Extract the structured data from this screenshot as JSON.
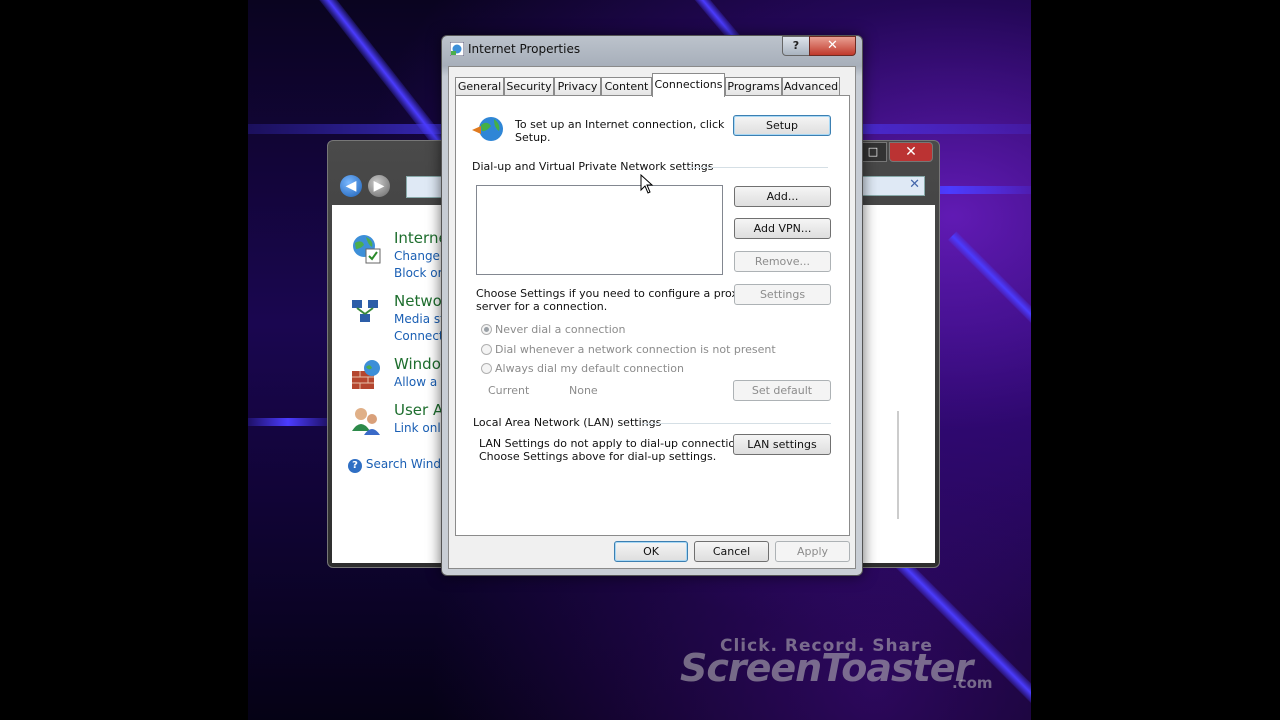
{
  "dialog": {
    "title": "Internet Properties",
    "help_button": "?",
    "close_button": "✕",
    "tabs": [
      {
        "label": "General"
      },
      {
        "label": "Security"
      },
      {
        "label": "Privacy"
      },
      {
        "label": "Content"
      },
      {
        "label": "Connections",
        "active": true
      },
      {
        "label": "Programs"
      },
      {
        "label": "Advanced"
      }
    ],
    "setup": {
      "text_line1": "To set up an Internet connection, click",
      "text_line2": "Setup.",
      "button": "Setup"
    },
    "dialup": {
      "heading": "Dial-up and Virtual Private Network settings",
      "add_button": "Add...",
      "add_vpn_button": "Add VPN...",
      "remove_button": "Remove...",
      "settings_button": "Settings",
      "proxy_text_line1": "Choose Settings if you need to configure a proxy",
      "proxy_text_line2": "server for a connection.",
      "radios": [
        {
          "label": "Never dial a connection",
          "checked": true
        },
        {
          "label": "Dial whenever a network connection is not present",
          "checked": false
        },
        {
          "label": "Always dial my default connection",
          "checked": false
        }
      ],
      "current_label": "Current",
      "current_value": "None",
      "set_default_button": "Set default"
    },
    "lan": {
      "heading": "Local Area Network (LAN) settings",
      "text_line1": "LAN Settings do not apply to dial-up connections.",
      "text_line2": "Choose Settings above for dial-up settings.",
      "button": "LAN settings"
    },
    "footer": {
      "ok": "OK",
      "cancel": "Cancel",
      "apply": "Apply"
    }
  },
  "control_panel": {
    "close_button": "✕",
    "max_button": "□",
    "search_clear": "✕",
    "items": [
      {
        "title": "Interne",
        "links": [
          "Change",
          "Block or"
        ],
        "icon": "internet-options-icon"
      },
      {
        "title": "Netwo",
        "links": [
          "Media st",
          "Connect"
        ],
        "icon": "network-icon"
      },
      {
        "title": "Windo",
        "links": [
          "Allow a p"
        ],
        "icon": "firewall-icon"
      },
      {
        "title": "User A",
        "links": [
          "Link onl"
        ],
        "icon": "user-accounts-icon"
      }
    ],
    "help_link": "Search Windo"
  },
  "watermark": {
    "tagline": "Click. Record. Share",
    "brand": "ScreenToaster",
    "suffix": ".com"
  },
  "colors": {
    "dialog_frame": "#a7afba",
    "link": "#1a5fb4",
    "cp_title": "#1e6e2e",
    "desktop_beam": "#4b3cff",
    "close_red": "#c0392b"
  }
}
